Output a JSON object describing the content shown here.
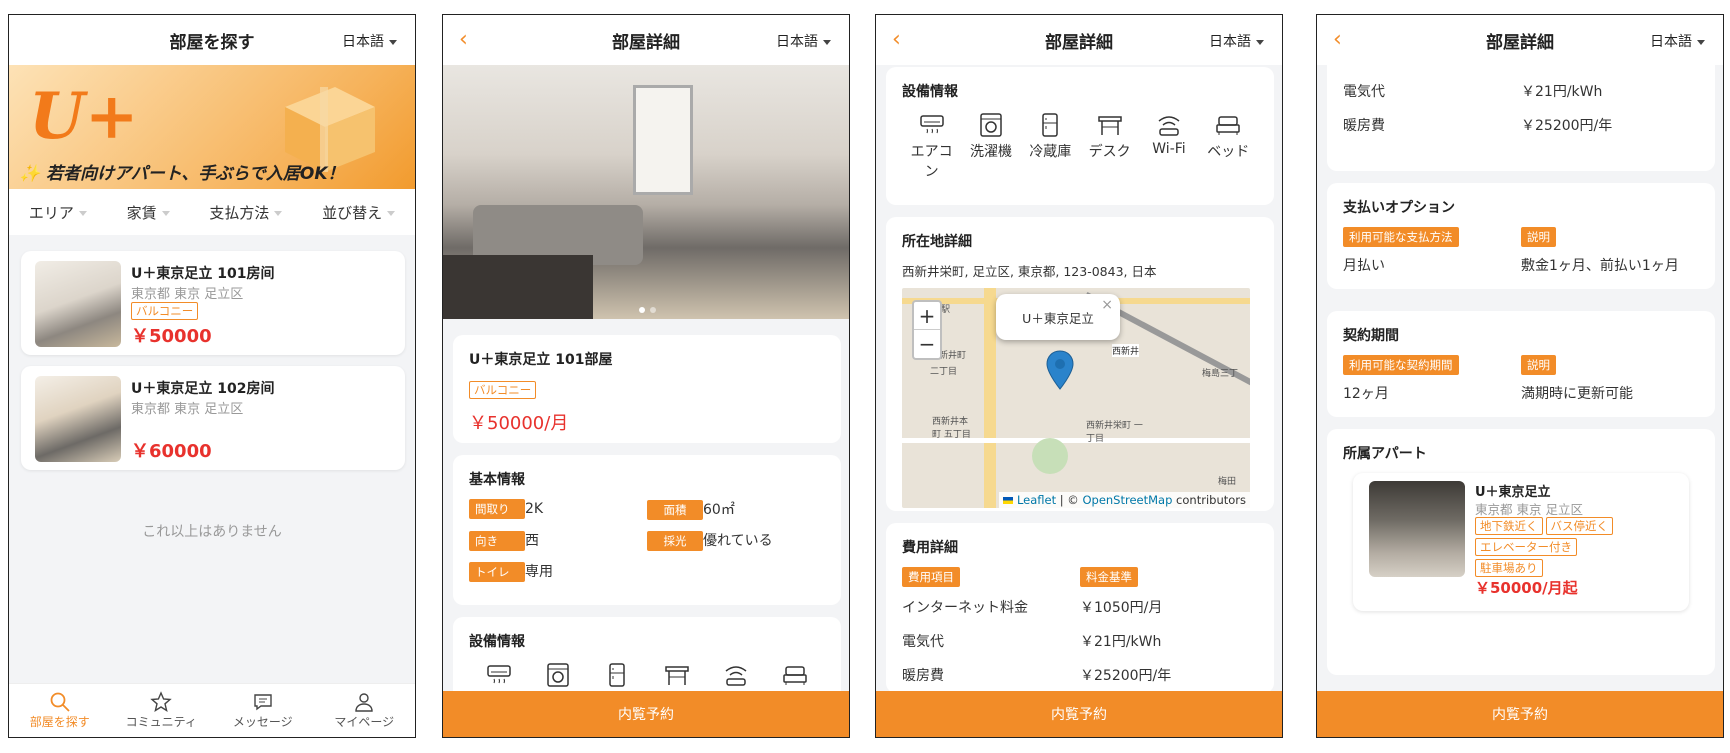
{
  "search": {
    "title": "部屋を探す",
    "lang": "日本語",
    "banner_logo": "U+",
    "banner_slogan": "✨ 若者向けアパート、手ぶらで入居OK！",
    "filters": [
      "エリア",
      "家賃",
      "支払方法",
      "並び替え"
    ],
    "listings": [
      {
        "name": "U＋東京足立 101房间",
        "location": "東京都 東京 足立区",
        "tag": "バルコニー",
        "price": "￥50000"
      },
      {
        "name": "U＋東京足立 102房间",
        "location": "東京都 東京 足立区",
        "tag": "",
        "price": "￥60000"
      }
    ],
    "end_text": "これ以上はありません",
    "nav": [
      {
        "label": "部屋を探す",
        "icon": "search-icon"
      },
      {
        "label": "コミュニティ",
        "icon": "star-icon"
      },
      {
        "label": "メッセージ",
        "icon": "message-icon"
      },
      {
        "label": "マイページ",
        "icon": "user-icon"
      }
    ]
  },
  "detail": {
    "title": "部屋詳細",
    "lang": "日本語",
    "back": "‹",
    "name": "U＋東京足立 101部屋",
    "tag": "バルコニー",
    "price": "￥50000/月",
    "basic_title": "基本情報",
    "basic": [
      {
        "k": "間取り",
        "v": "2K"
      },
      {
        "k": "面積",
        "v": "60㎡"
      },
      {
        "k": "向き",
        "v": "西"
      },
      {
        "k": "採光",
        "v": "優れている"
      },
      {
        "k": "トイレ",
        "v": "専用"
      }
    ],
    "facilities_title": "設備情報",
    "facilities": [
      {
        "label": "エアコン",
        "icon": "air-conditioner-icon"
      },
      {
        "label": "洗濯機",
        "icon": "washing-machine-icon"
      },
      {
        "label": "冷蔵庫",
        "icon": "fridge-icon"
      },
      {
        "label": "デスク",
        "icon": "desk-icon"
      },
      {
        "label": "Wi-Fi",
        "icon": "wifi-icon"
      },
      {
        "label": "ベッド",
        "icon": "bed-icon"
      }
    ],
    "location_title": "所在地詳細",
    "address": "西新井栄町, 足立区, 東京都, 123-0843, 日本",
    "popup": "U＋東京足立",
    "map_labels": [
      "西新井駅",
      "西新井町",
      "西新井本町 五丁目",
      "西新井栄町 一丁目",
      "梅島三丁",
      "梅田",
      "二丁目",
      "西新井"
    ],
    "attribution": {
      "leaflet": "Leaflet",
      "sep": " | © ",
      "osm": "OpenStreetMap",
      "rest": " contributors"
    },
    "fee_title": "費用詳細",
    "fee_head": [
      "費用項目",
      "料金基準"
    ],
    "fees": [
      {
        "k": "インターネット料金",
        "v": "￥1050円/月"
      },
      {
        "k": "電気代",
        "v": "￥21円/kWh"
      },
      {
        "k": "暖房費",
        "v": "￥25200円/年"
      }
    ],
    "pay_title": "支払いオプション",
    "pay_head": [
      "利用可能な支払方法",
      "説明"
    ],
    "pay": {
      "k": "月払い",
      "v": "敷金1ヶ月、前払い1ヶ月"
    },
    "term_title": "契約期間",
    "term_head": [
      "利用可能な契約期間",
      "説明"
    ],
    "term": {
      "k": "12ヶ月",
      "v": "満期時に更新可能"
    },
    "apt_title": "所属アパート",
    "apt": {
      "name": "U＋東京足立",
      "location": "東京都 東京 足立区",
      "tags": [
        "地下鉄近く",
        "バス停近く",
        "エレベーター付き",
        "駐車場あり"
      ],
      "price": "￥50000/月起"
    },
    "book": "内覧予約"
  },
  "colors": {
    "accent": "#f28c28",
    "price": "#e8322d"
  }
}
